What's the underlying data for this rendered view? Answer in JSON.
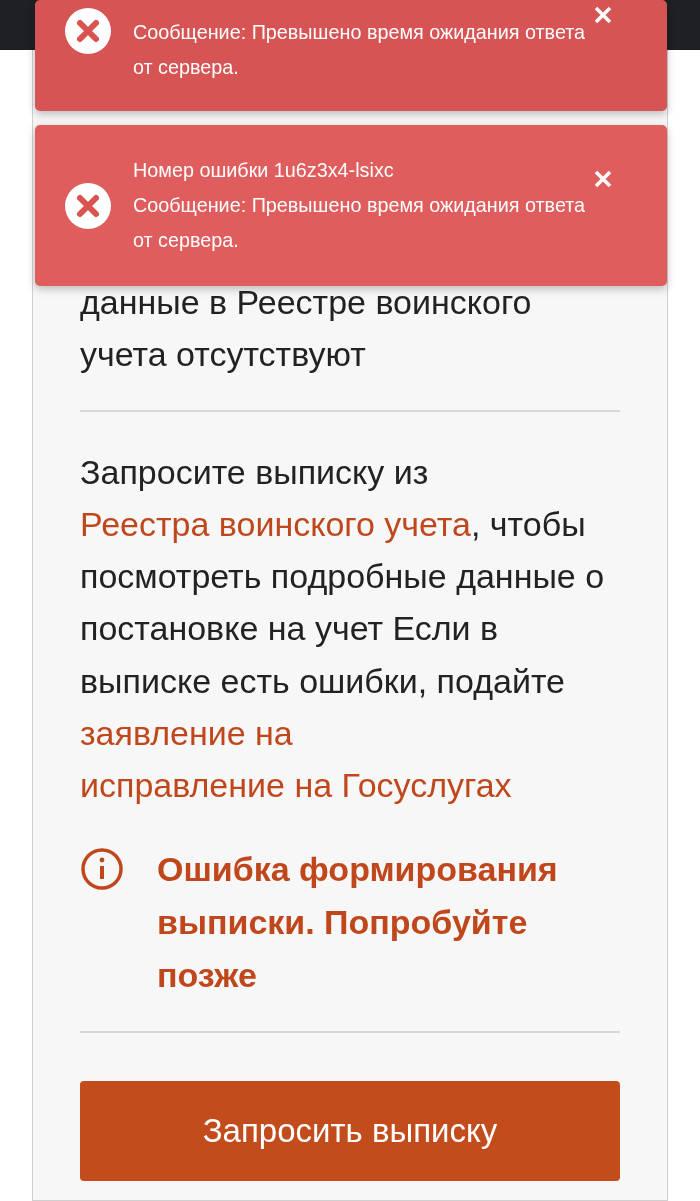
{
  "card": {
    "status_text": "данные в Реестре воинского учета отсутствуют",
    "instructions": [
      {
        "kind": "text",
        "text": "Запросите выписку из "
      },
      {
        "kind": "link",
        "text": "Реестра воинского учета"
      },
      {
        "kind": "text",
        "text": ", чтобы посмотреть подробные данные о постановке на учет Если в выписке есть ошибки, подайте "
      },
      {
        "kind": "link",
        "text": "заявление на"
      },
      {
        "kind": "link",
        "text": "исправление на Госуслугах"
      }
    ],
    "error_notice": "Ошибка формирования выписки. Попробуйте позже",
    "button": "Запросить выписку"
  },
  "toasts": [
    {
      "message": "Сообщение: Превышено время ожидания ответа от сервера."
    },
    {
      "title": "Номер ошибки 1u6z3x4-lsixc",
      "message": "Сообщение: Превышено время ожидания ответа от сервера."
    }
  ]
}
